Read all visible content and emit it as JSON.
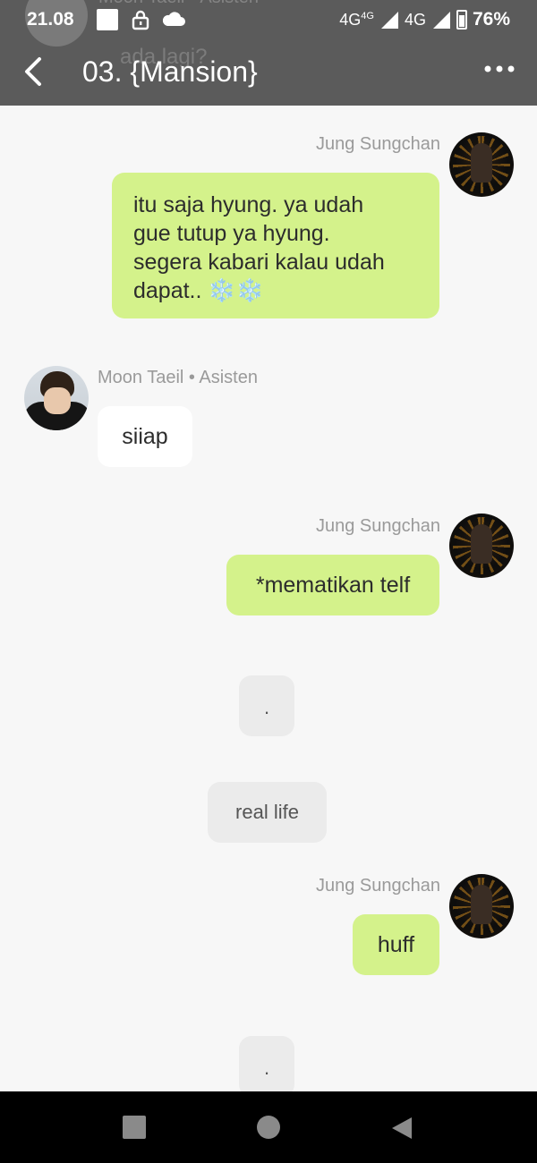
{
  "status_bar": {
    "time": "21.08",
    "network1": "4G",
    "network1_sup": "4G",
    "network2": "4G",
    "battery": "76%"
  },
  "background_preview": {
    "sender": "Moon Taeil • Asisten",
    "text": "ada lagi?"
  },
  "app_bar": {
    "title": "03. {Mansion}",
    "back_icon": "chevron-left-icon",
    "more_icon": "more-horizontal-icon"
  },
  "messages": [
    {
      "type": "me",
      "sender": "Jung Sungchan",
      "lines": [
        "itu saja hyung. ya udah",
        "gue tutup ya hyung.",
        "segera kabari kalau udah",
        "dapat.. ❄️❄️"
      ]
    },
    {
      "type": "other",
      "sender": "Moon Taeil • Asisten",
      "text": "siiap"
    },
    {
      "type": "me",
      "sender": "Jung Sungchan",
      "text": "*mematikan telf"
    },
    {
      "type": "system",
      "text": "."
    },
    {
      "type": "system",
      "text": "real life"
    },
    {
      "type": "me",
      "sender": "Jung Sungchan",
      "text": "huff"
    },
    {
      "type": "system",
      "text": "."
    }
  ],
  "colors": {
    "header": "#5b5b5b",
    "my_bubble": "#d4f28b",
    "other_bubble": "#ffffff",
    "system_bubble": "#ebebeb",
    "background": "#f7f7f7"
  },
  "nav_bar": {
    "recents_icon": "square-icon",
    "home_icon": "circle-icon",
    "back_icon": "triangle-back-icon"
  }
}
